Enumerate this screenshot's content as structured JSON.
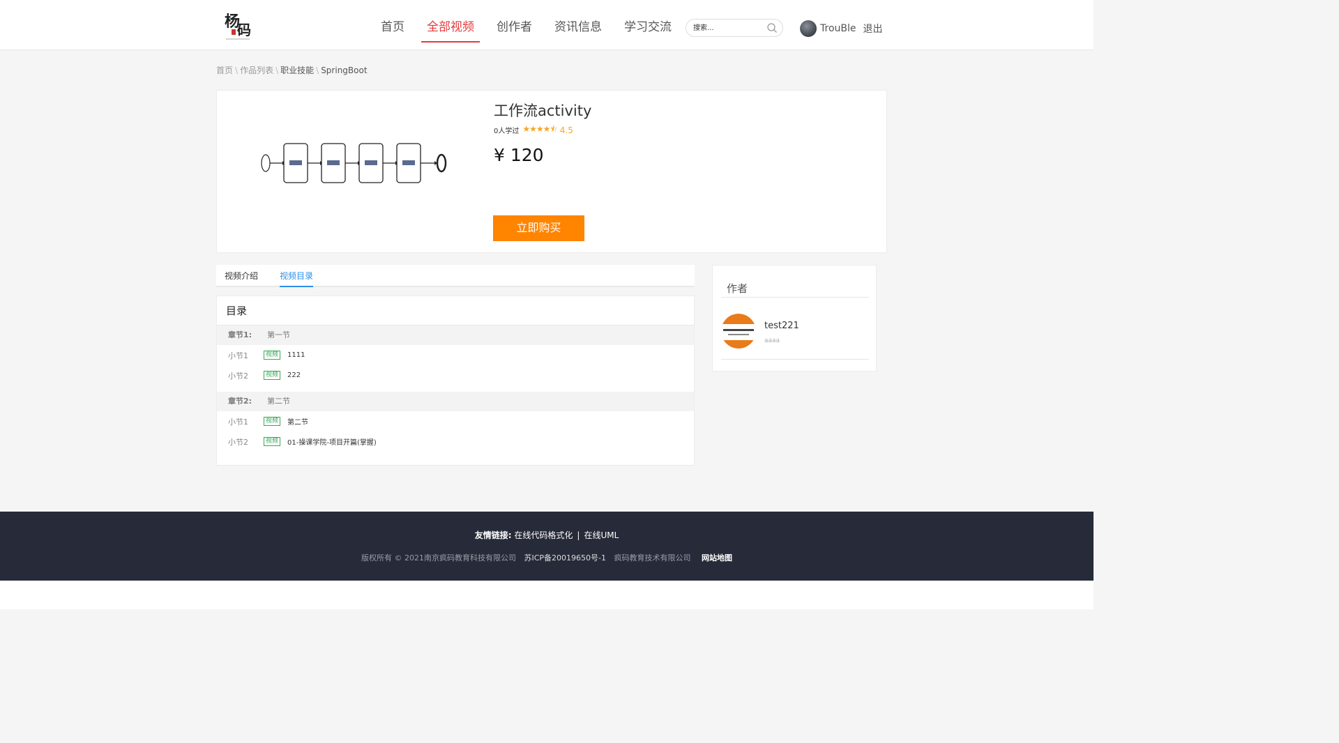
{
  "header": {
    "nav": [
      {
        "label": "首页",
        "active": false
      },
      {
        "label": "全部视频",
        "active": true
      },
      {
        "label": "创作者",
        "active": false
      },
      {
        "label": "资讯信息",
        "active": false
      },
      {
        "label": "学习交流",
        "active": false
      }
    ],
    "search_placeholder": "搜索...",
    "username": "TrouBle",
    "logout": "退出"
  },
  "breadcrumb": [
    "首页",
    "作品列表",
    "职业技能",
    "SpringBoot"
  ],
  "product": {
    "title": "工作流activity",
    "learners": "0人学过",
    "rating": "4.5",
    "price": "¥ 120",
    "buy_label": "立即购买"
  },
  "tabs": [
    {
      "label": "视频介绍",
      "active": false
    },
    {
      "label": "视频目录",
      "active": true
    }
  ],
  "catalog": {
    "title": "目录",
    "chapters": [
      {
        "label": "章节1:",
        "title": "第一节",
        "lessons": [
          {
            "label": "小节1",
            "tag": "视频",
            "title": "1111"
          },
          {
            "label": "小节2",
            "tag": "视频",
            "title": "222"
          }
        ]
      },
      {
        "label": "章节2:",
        "title": "第二节",
        "lessons": [
          {
            "label": "小节1",
            "tag": "视频",
            "title": "第二节"
          },
          {
            "label": "小节2",
            "tag": "视频",
            "title": "01-操课学院-项目开篇(掌握)"
          }
        ]
      }
    ]
  },
  "author": {
    "heading": "作者",
    "name": "test221",
    "desc": "aaaa"
  },
  "footer": {
    "links_label": "友情链接:",
    "links": [
      "在线代码格式化",
      "在线UML"
    ],
    "copyright": "版权所有 © 2021南京疯码教育科技有限公司",
    "icp": "苏ICP备20019650号-1",
    "company": "疯码教育技术有限公司",
    "sitemap": "网站地图"
  },
  "colors": {
    "accent_red": "#e4393c",
    "tab_blue": "#2f8fe6",
    "buy_orange": "#ff8400",
    "star": "#f5a623",
    "footer_bg": "#272a39"
  }
}
